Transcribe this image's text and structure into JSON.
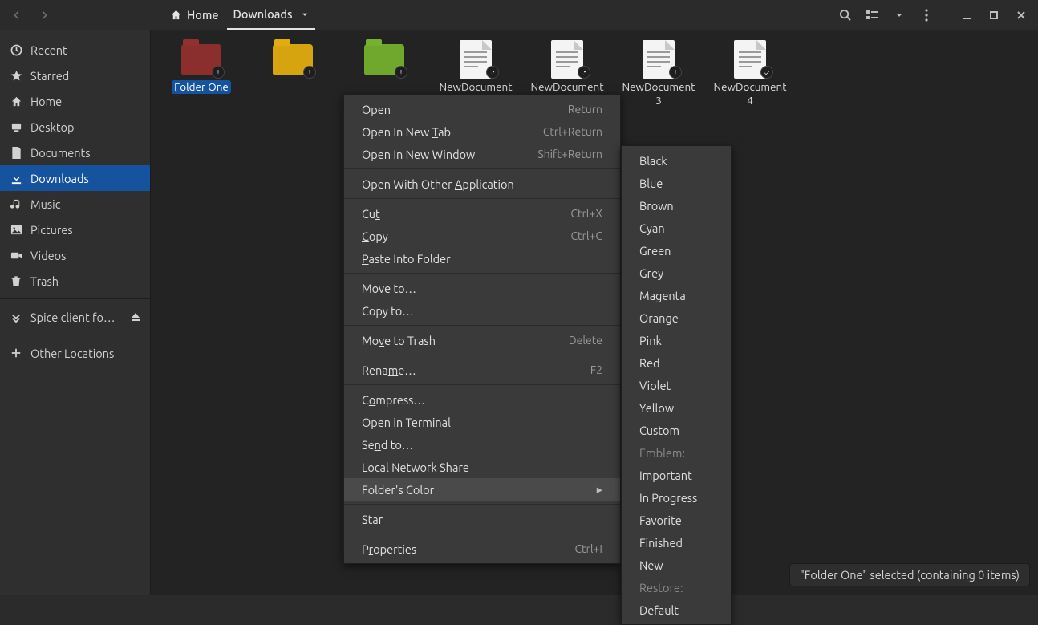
{
  "header": {
    "path": [
      {
        "label": "Home",
        "active": false
      },
      {
        "label": "Downloads",
        "active": true
      }
    ]
  },
  "sidebar": {
    "items": [
      {
        "icon": "clock",
        "label": "Recent"
      },
      {
        "icon": "star",
        "label": "Starred"
      },
      {
        "icon": "home",
        "label": "Home"
      },
      {
        "icon": "desktop",
        "label": "Desktop"
      },
      {
        "icon": "doc",
        "label": "Documents"
      },
      {
        "icon": "download",
        "label": "Downloads",
        "selected": true
      },
      {
        "icon": "music",
        "label": "Music"
      },
      {
        "icon": "picture",
        "label": "Pictures"
      },
      {
        "icon": "video",
        "label": "Videos"
      },
      {
        "icon": "trash",
        "label": "Trash"
      }
    ],
    "mount": {
      "label": "Spice client fo…"
    },
    "other": {
      "label": "Other Locations"
    }
  },
  "grid": {
    "items": [
      {
        "kind": "folder",
        "color": "red",
        "label": "Folder One",
        "selected": true,
        "badge": "new"
      },
      {
        "kind": "folder",
        "color": "yellow",
        "label": "",
        "badge": "new"
      },
      {
        "kind": "folder",
        "color": "green",
        "label": "",
        "badge": "new"
      },
      {
        "kind": "doc",
        "label": "NewDocument",
        "badge": "clock"
      },
      {
        "kind": "doc",
        "label": "NewDocument 2",
        "badge": "clock"
      },
      {
        "kind": "doc",
        "label": "NewDocument 3",
        "badge": "clock-alert"
      },
      {
        "kind": "doc",
        "label": "NewDocument 4",
        "badge": "check"
      }
    ]
  },
  "context_menu": {
    "groups": [
      [
        {
          "label": "Open",
          "accel": "Return"
        },
        {
          "label": "Open In New Tab",
          "mnemonic": "T",
          "accel": "Ctrl+Return"
        },
        {
          "label": "Open In New Window",
          "mnemonic": "W",
          "accel": "Shift+Return"
        }
      ],
      [
        {
          "label": "Open With Other Application",
          "mnemonic": "A"
        }
      ],
      [
        {
          "label": "Cut",
          "mnemonic": "t",
          "accel": "Ctrl+X"
        },
        {
          "label": "Copy",
          "mnemonic": "C",
          "accel": "Ctrl+C"
        },
        {
          "label": "Paste Into Folder",
          "mnemonic": "P"
        }
      ],
      [
        {
          "label": "Move to…"
        },
        {
          "label": "Copy to…"
        }
      ],
      [
        {
          "label": "Move to Trash",
          "mnemonic": "v",
          "accel": "Delete"
        }
      ],
      [
        {
          "label": "Rename…",
          "mnemonic": "m",
          "accel": "F2"
        }
      ],
      [
        {
          "label": "Compress…",
          "mnemonic": "o"
        },
        {
          "label": "Open in Terminal",
          "mnemonic": "e"
        },
        {
          "label": "Send to…",
          "mnemonic": "n"
        },
        {
          "label": "Local Network Share"
        },
        {
          "label": "Folder's Color",
          "submenu": true,
          "hover": true
        }
      ],
      [
        {
          "label": "Star"
        }
      ],
      [
        {
          "label": "Properties",
          "mnemonic": "r",
          "accel": "Ctrl+I"
        }
      ]
    ]
  },
  "submenu": {
    "colors": [
      "Black",
      "Blue",
      "Brown",
      "Cyan",
      "Green",
      "Grey",
      "Magenta",
      "Orange",
      "Pink",
      "Red",
      "Violet",
      "Yellow",
      "Custom"
    ],
    "emblem_header": "Emblem:",
    "emblems": [
      "Important",
      "In Progress",
      "Favorite",
      "Finished",
      "New"
    ],
    "restore_header": "Restore:",
    "restore": [
      "Default"
    ]
  },
  "status": {
    "text": "\"Folder One\" selected  (containing 0 items)"
  }
}
